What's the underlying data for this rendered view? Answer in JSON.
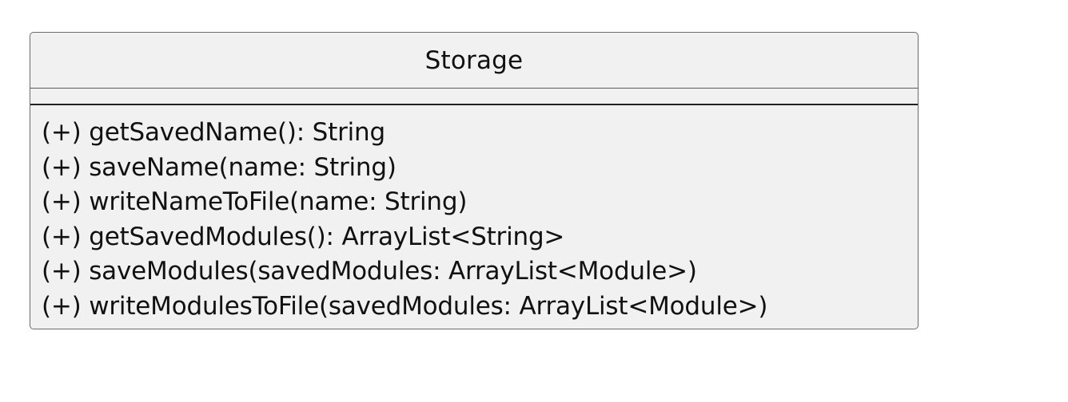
{
  "diagram": {
    "class_name": "Storage",
    "attributes": [],
    "methods": [
      "(+) getSavedName(): String",
      "(+) saveName(name: String)",
      "(+) writeNameToFile(name: String)",
      "(+) getSavedModules(): ArrayList<String>",
      "(+) saveModules(savedModules: ArrayList<Module>)",
      "(+) writeModulesToFile(savedModules: ArrayList<Module>)"
    ]
  },
  "colors": {
    "box_fill": "#f1f1f1",
    "box_border": "#6b6b6b",
    "text": "#111111",
    "background": "#ffffff"
  }
}
